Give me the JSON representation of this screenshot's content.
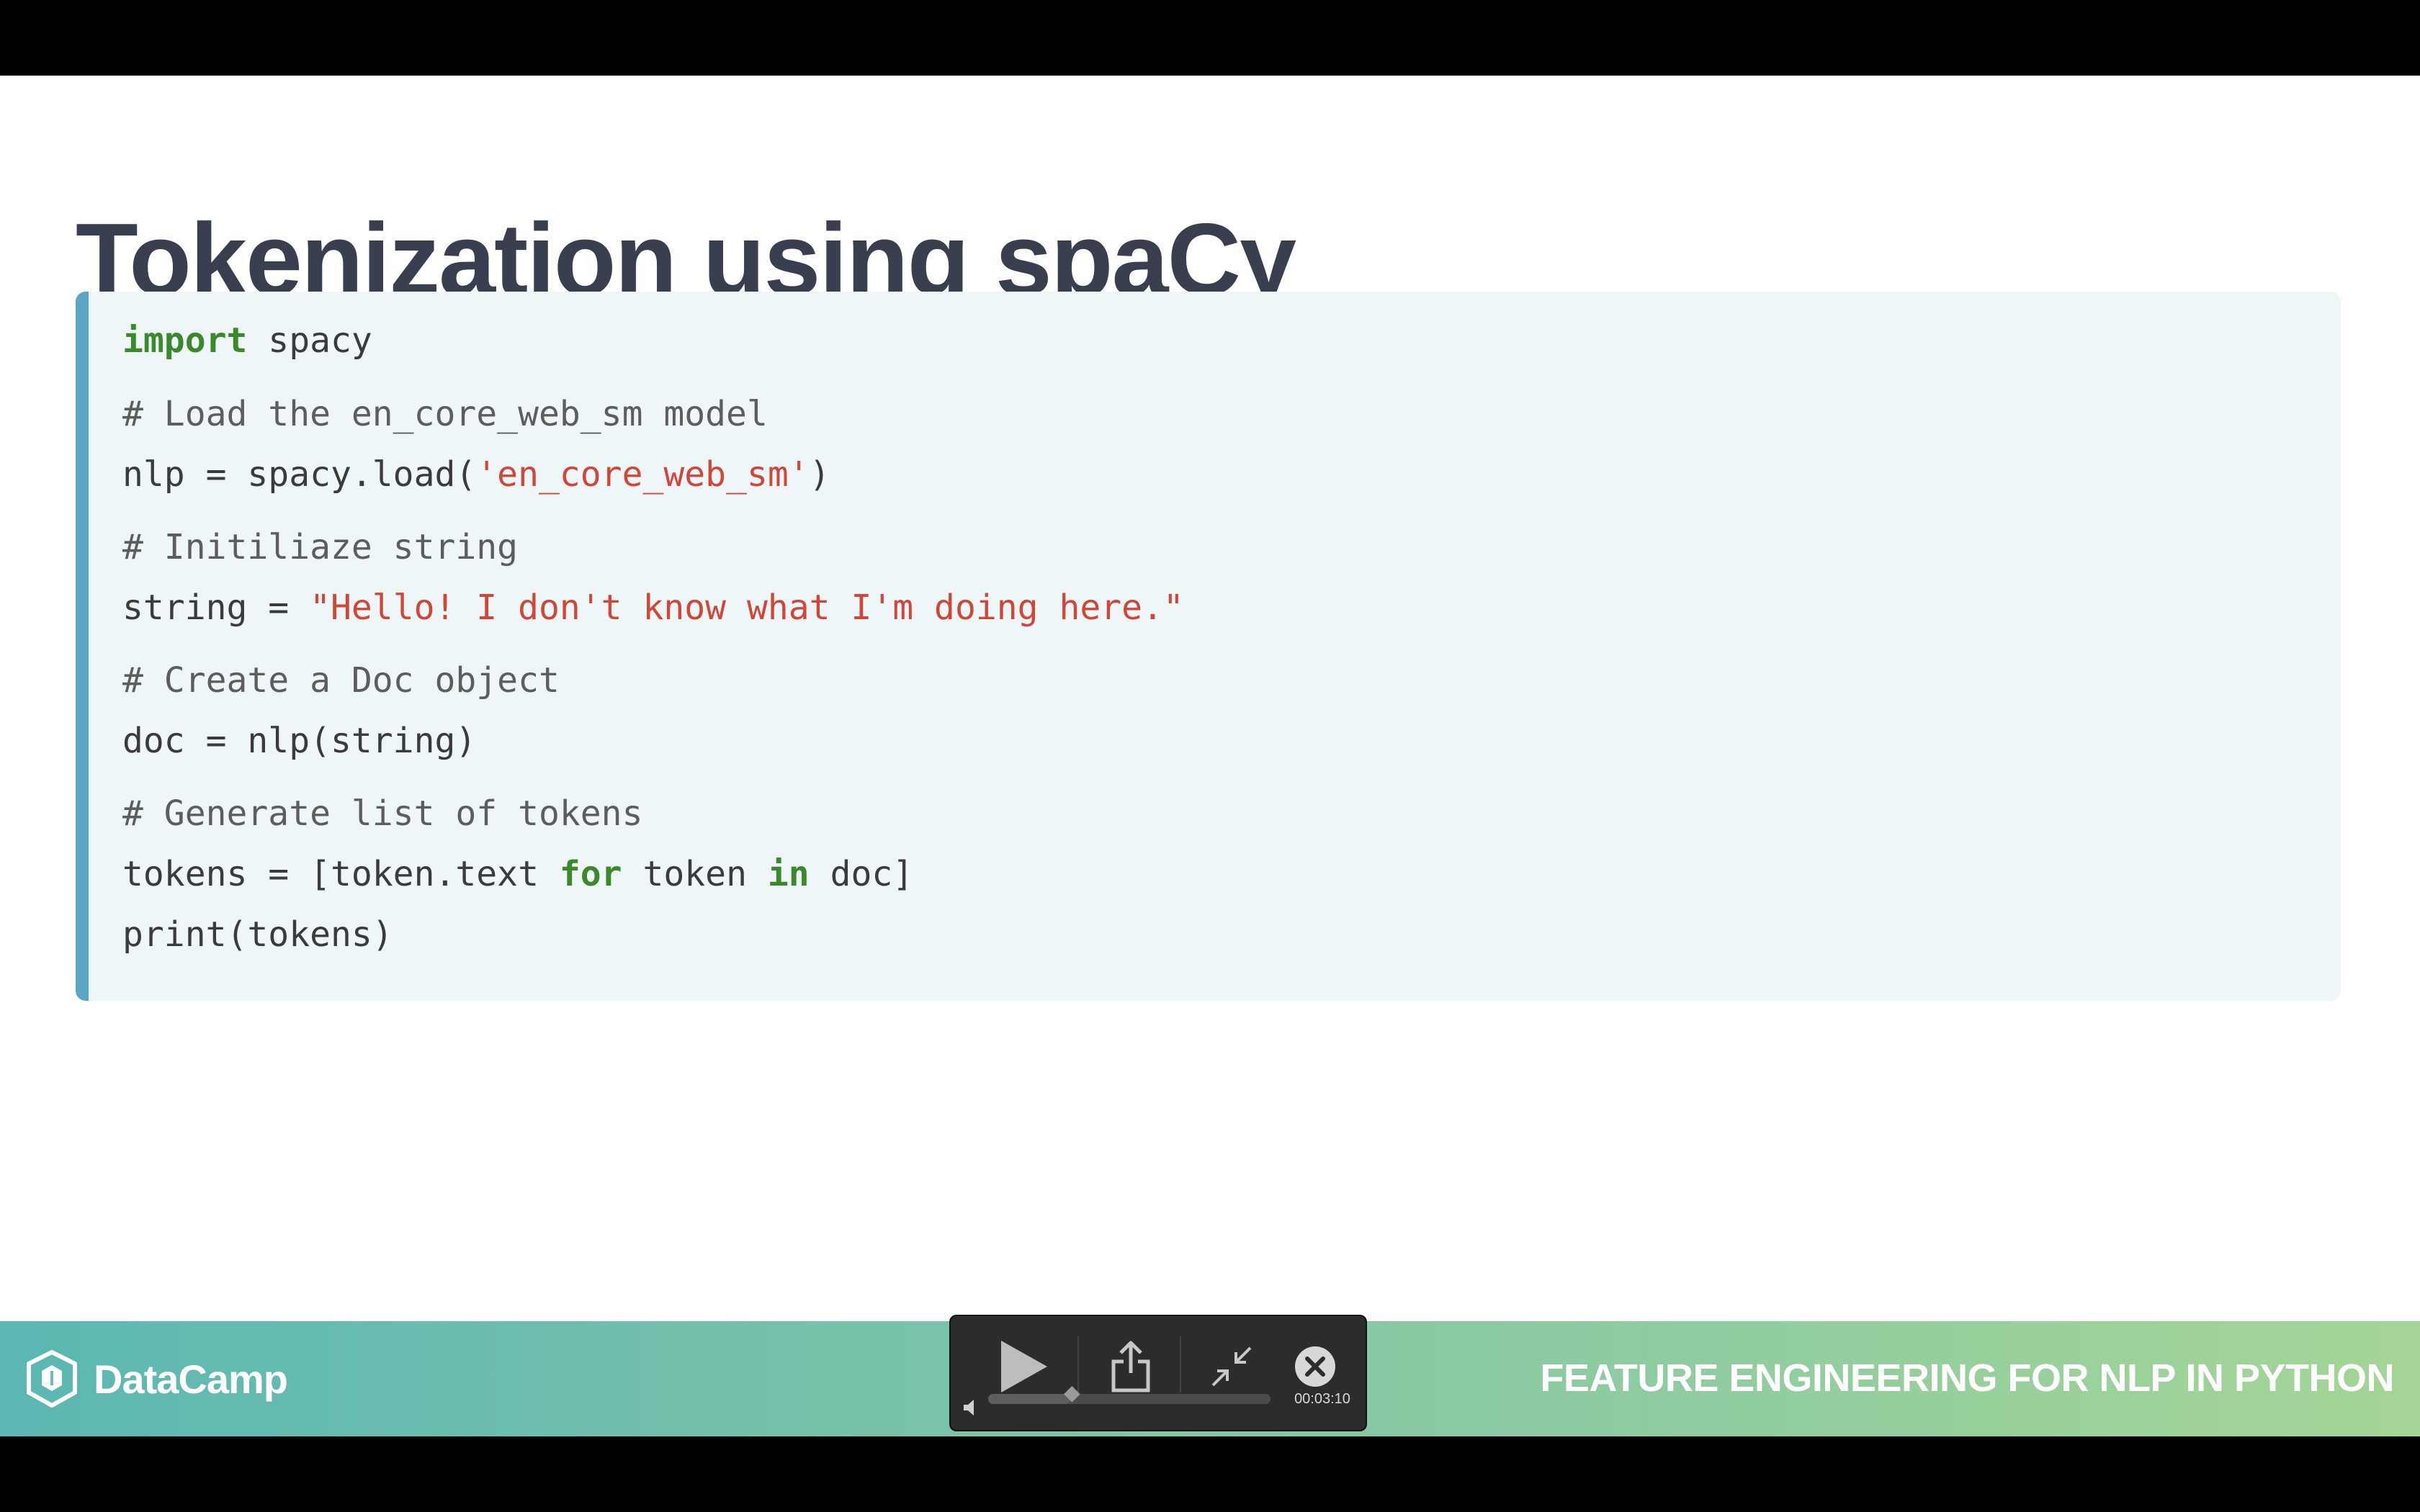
{
  "slide": {
    "title": "Tokenization using spaCy"
  },
  "code": {
    "lines": [
      [
        {
          "t": "import",
          "k": "kw"
        },
        {
          "t": " spacy",
          "k": "tx"
        }
      ],
      [
        {
          "t": "# Load the en_core_web_sm model",
          "k": "cm"
        }
      ],
      [
        {
          "t": "nlp = spacy.load(",
          "k": "tx"
        },
        {
          "t": "'en_core_web_sm'",
          "k": "str"
        },
        {
          "t": ")",
          "k": "tx"
        }
      ],
      [
        {
          "t": "# Initiliaze string",
          "k": "cm"
        }
      ],
      [
        {
          "t": "string = ",
          "k": "tx"
        },
        {
          "t": "\"Hello! I don't know what I'm doing here.\"",
          "k": "str"
        }
      ],
      [
        {
          "t": "# Create a Doc object",
          "k": "cm"
        }
      ],
      [
        {
          "t": "doc = nlp(string)",
          "k": "tx"
        }
      ],
      [
        {
          "t": "# Generate list of tokens",
          "k": "cm"
        }
      ],
      [
        {
          "t": "tokens = [token.text ",
          "k": "tx"
        },
        {
          "t": "for",
          "k": "kw"
        },
        {
          "t": " token ",
          "k": "tx"
        },
        {
          "t": "in",
          "k": "kw"
        },
        {
          "t": " doc]",
          "k": "tx"
        }
      ],
      [
        {
          "t": "print(tokens)",
          "k": "tx"
        }
      ]
    ]
  },
  "footer": {
    "brand": "DataCamp",
    "course": "FEATURE ENGINEERING FOR NLP IN PYTHON"
  },
  "player": {
    "time": "00:03:10",
    "progress": 0.29,
    "icons": [
      "play-icon",
      "share-icon",
      "exit-fullscreen-icon",
      "close-icon",
      "volume-icon"
    ]
  },
  "colors": {
    "title": "#3a3f4f",
    "code_bg": "#eff6f8",
    "code_border": "#5aa6c6",
    "keyword": "#3a8a2c",
    "string": "#d2463a",
    "footer_left": "#5cb7b3",
    "footer_right": "#a4d596"
  }
}
